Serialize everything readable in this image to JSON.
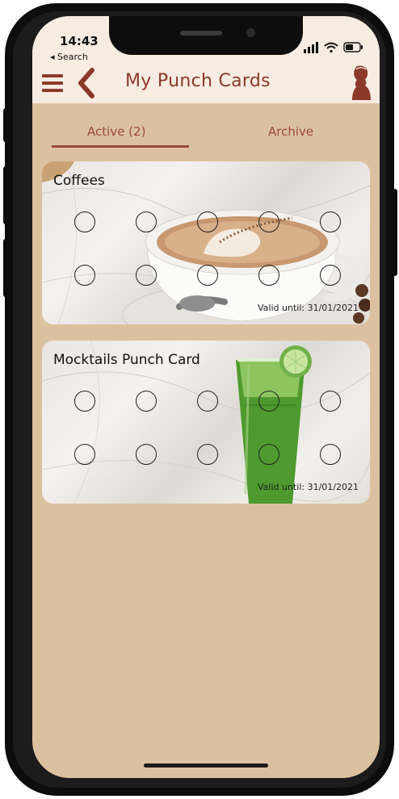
{
  "status_bar": {
    "time": "14:43",
    "back_label": "◂ Search"
  },
  "header": {
    "title": "My Punch Cards",
    "menu_icon": "hamburger-icon",
    "back_icon": "chevron-left-icon",
    "profile_icon": "profile-silhouette-icon"
  },
  "tabs": [
    {
      "label": "Active (2)",
      "selected": true
    },
    {
      "label": "Archive",
      "selected": false
    }
  ],
  "cards": [
    {
      "title": "Coffees",
      "valid": "Valid until: 31/01/2021",
      "punches_total": 10,
      "image": "cappuccino-photo"
    },
    {
      "title": "Mocktails Punch Card",
      "valid": "Valid until: 31/01/2021",
      "punches_total": 10,
      "image": "green-juice-photo"
    }
  ],
  "colors": {
    "accent": "#8b3a2a",
    "background": "#dcc1a0",
    "header_bg": "#f7ece2"
  }
}
